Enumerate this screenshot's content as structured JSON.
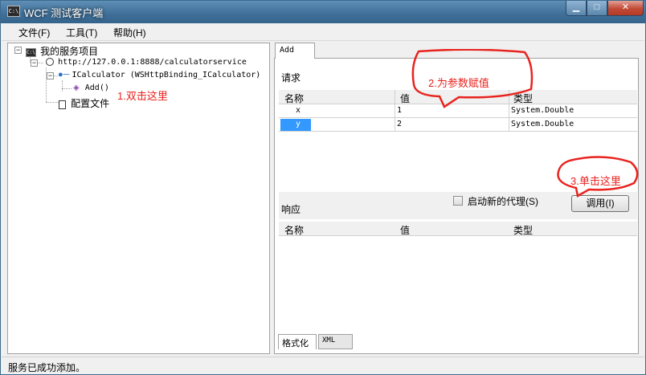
{
  "window": {
    "title": "WCF 测试客户端",
    "icon_text": "C:\\"
  },
  "window_controls": {
    "minimize": "▁",
    "maximize": "□",
    "close": "✕"
  },
  "menu": {
    "items": [
      "文件(F)",
      "工具(T)",
      "帮助(H)"
    ]
  },
  "tree": {
    "root": "我的服务项目",
    "endpoint": "http://127.0.0.1:8888/calculatorservice",
    "contract": "ICalculator (WSHttpBinding_ICalculator)",
    "operation": "Add()",
    "config": "配置文件"
  },
  "operation_tab": "Add",
  "request": {
    "title": "请求",
    "columns": [
      "名称",
      "值",
      "类型"
    ],
    "rows": [
      {
        "name": "x",
        "value": "1",
        "type": "System.Double"
      },
      {
        "name": "y",
        "value": "2",
        "type": "System.Double"
      }
    ]
  },
  "response": {
    "title": "响应",
    "columns": [
      "名称",
      "值",
      "类型"
    ],
    "new_proxy_label": "启动新的代理(S)",
    "new_proxy_checked": false,
    "invoke_label": "调用(I)"
  },
  "bottom_tabs": [
    "格式化",
    "XML"
  ],
  "status": {
    "text": "服务已成功添加。"
  },
  "annotations": {
    "step1": "1.双击这里",
    "step2": "2.为参数赋值",
    "step3": "3.单击这里",
    "color": "#e8231e"
  }
}
